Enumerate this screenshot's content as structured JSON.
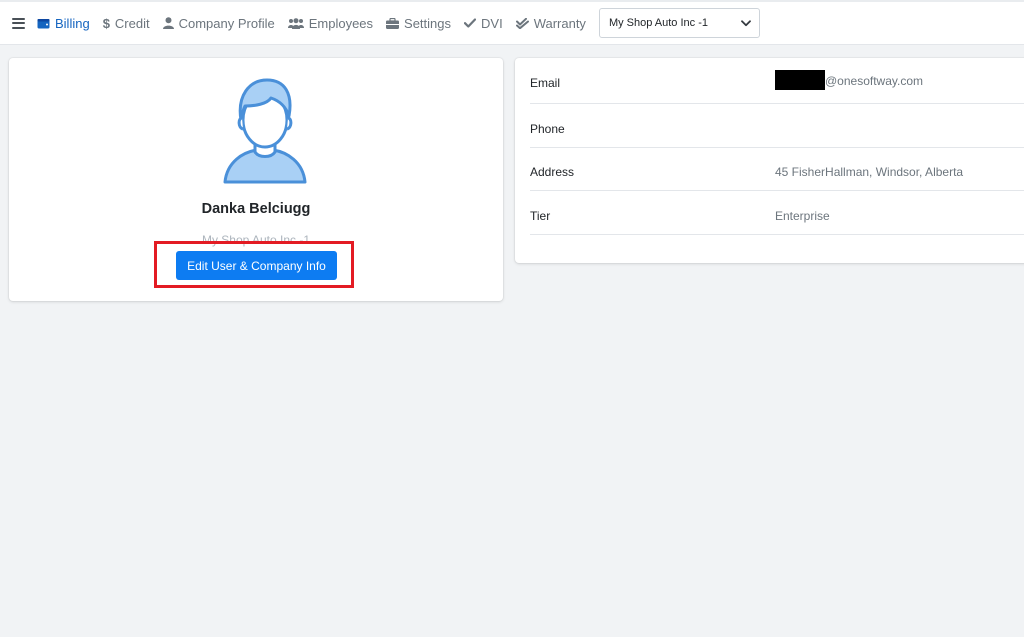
{
  "nav": {
    "items": [
      {
        "label": "Billing",
        "icon": "wallet-icon",
        "active": true
      },
      {
        "label": "Credit",
        "icon": "dollar-icon"
      },
      {
        "label": "Company Profile",
        "icon": "user-icon"
      },
      {
        "label": "Employees",
        "icon": "users-icon"
      },
      {
        "label": "Settings",
        "icon": "briefcase-icon"
      },
      {
        "label": "DVI",
        "icon": "check-icon"
      },
      {
        "label": "Warranty",
        "icon": "double-check-icon"
      }
    ],
    "shop_select": {
      "value": "My Shop Auto Inc -1"
    }
  },
  "profile": {
    "name": "Danka Belciugg",
    "company": "My Shop Auto Inc -1",
    "edit_button_label": "Edit User & Company Info"
  },
  "info": {
    "rows": [
      {
        "label": "Email",
        "value": "@onesoftway.com"
      },
      {
        "label": "Phone",
        "value": ""
      },
      {
        "label": "Address",
        "value": "45 FisherHallman, Windsor, Alberta"
      },
      {
        "label": "Tier",
        "value": "Enterprise"
      }
    ]
  },
  "colors": {
    "accent": "#0d7cf2",
    "active_nav": "#1565c0",
    "highlight": "#e31b23",
    "avatar_fill": "#a9d0f5",
    "avatar_stroke": "#4a90d9"
  }
}
